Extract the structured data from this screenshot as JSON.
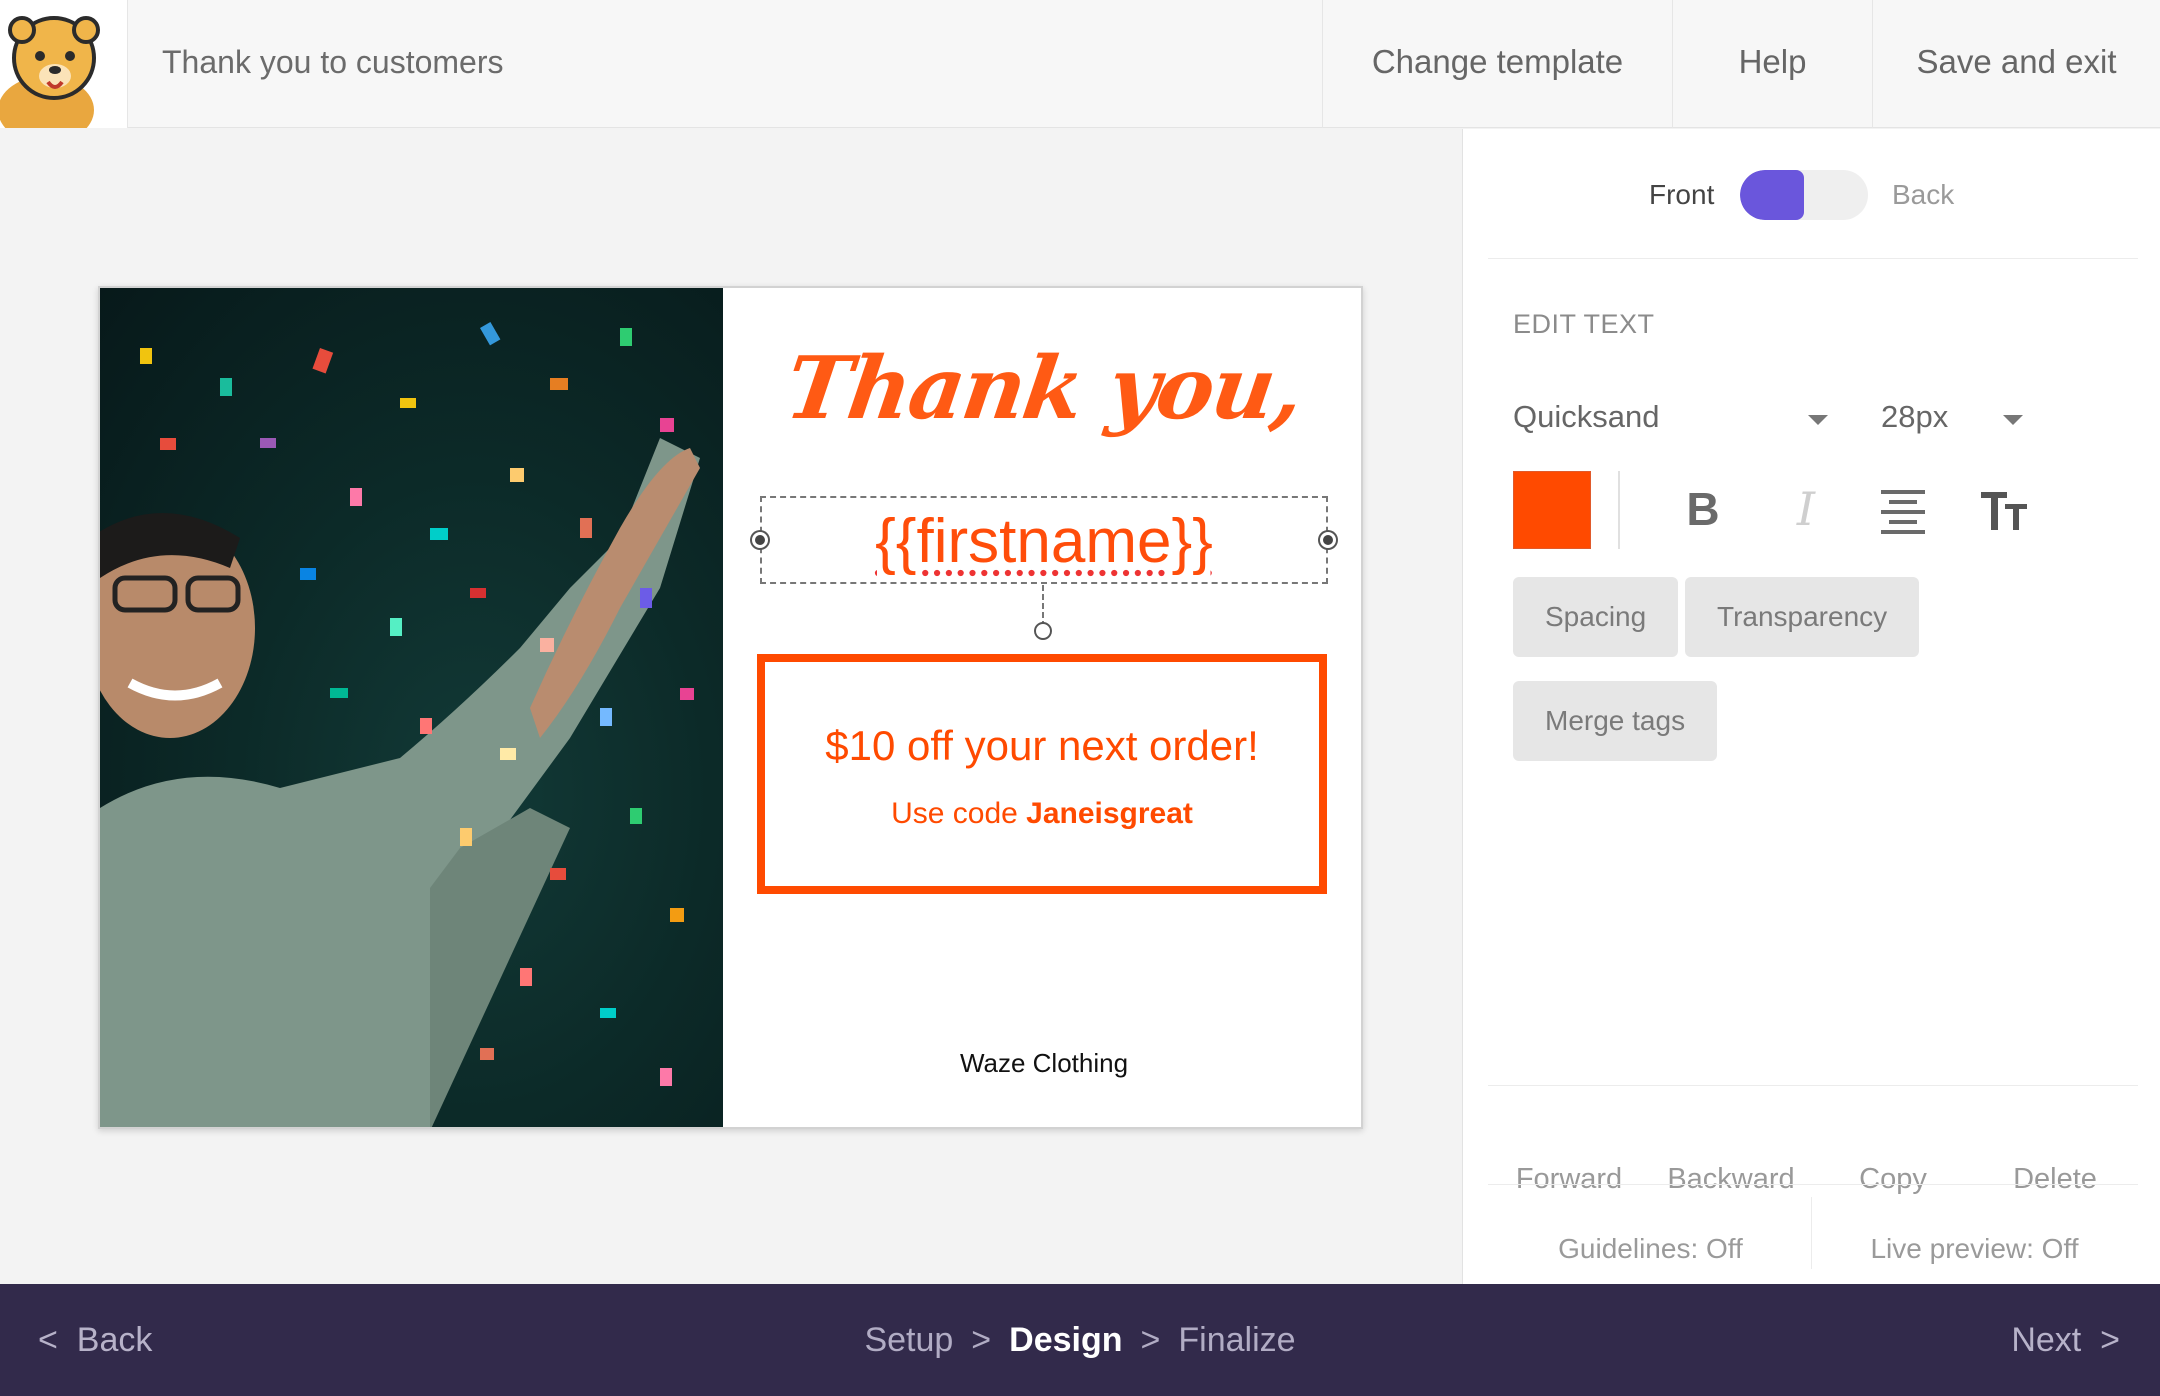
{
  "header": {
    "title": "Thank you to customers",
    "change_template": "Change template",
    "help": "Help",
    "save_exit": "Save and exit"
  },
  "card": {
    "headline": "Thank you,",
    "merge_field": "{{firstname}}",
    "promo_main": "$10 off your next order!",
    "promo_sub_prefix": "Use code ",
    "promo_code": "Janeisgreat",
    "brand": "Waze Clothing"
  },
  "panel": {
    "front_label": "Front",
    "back_label": "Back",
    "edit_heading": "EDIT TEXT",
    "font": "Quicksand",
    "size": "28px",
    "color": "#ff4a00",
    "accent": "#6a56dc",
    "bold_glyph": "B",
    "italic_glyph": "I",
    "textsize_glyph": "TT",
    "chips": [
      "Spacing",
      "Transparency",
      "Merge tags"
    ],
    "order": [
      "Forward",
      "Backward",
      "Copy",
      "Delete"
    ],
    "guidelines": "Guidelines: Off",
    "live_preview": "Live preview: Off"
  },
  "footer": {
    "back": "Back",
    "steps": [
      "Setup",
      "Design",
      "Finalize"
    ],
    "current_step": "Design",
    "next": "Next"
  }
}
